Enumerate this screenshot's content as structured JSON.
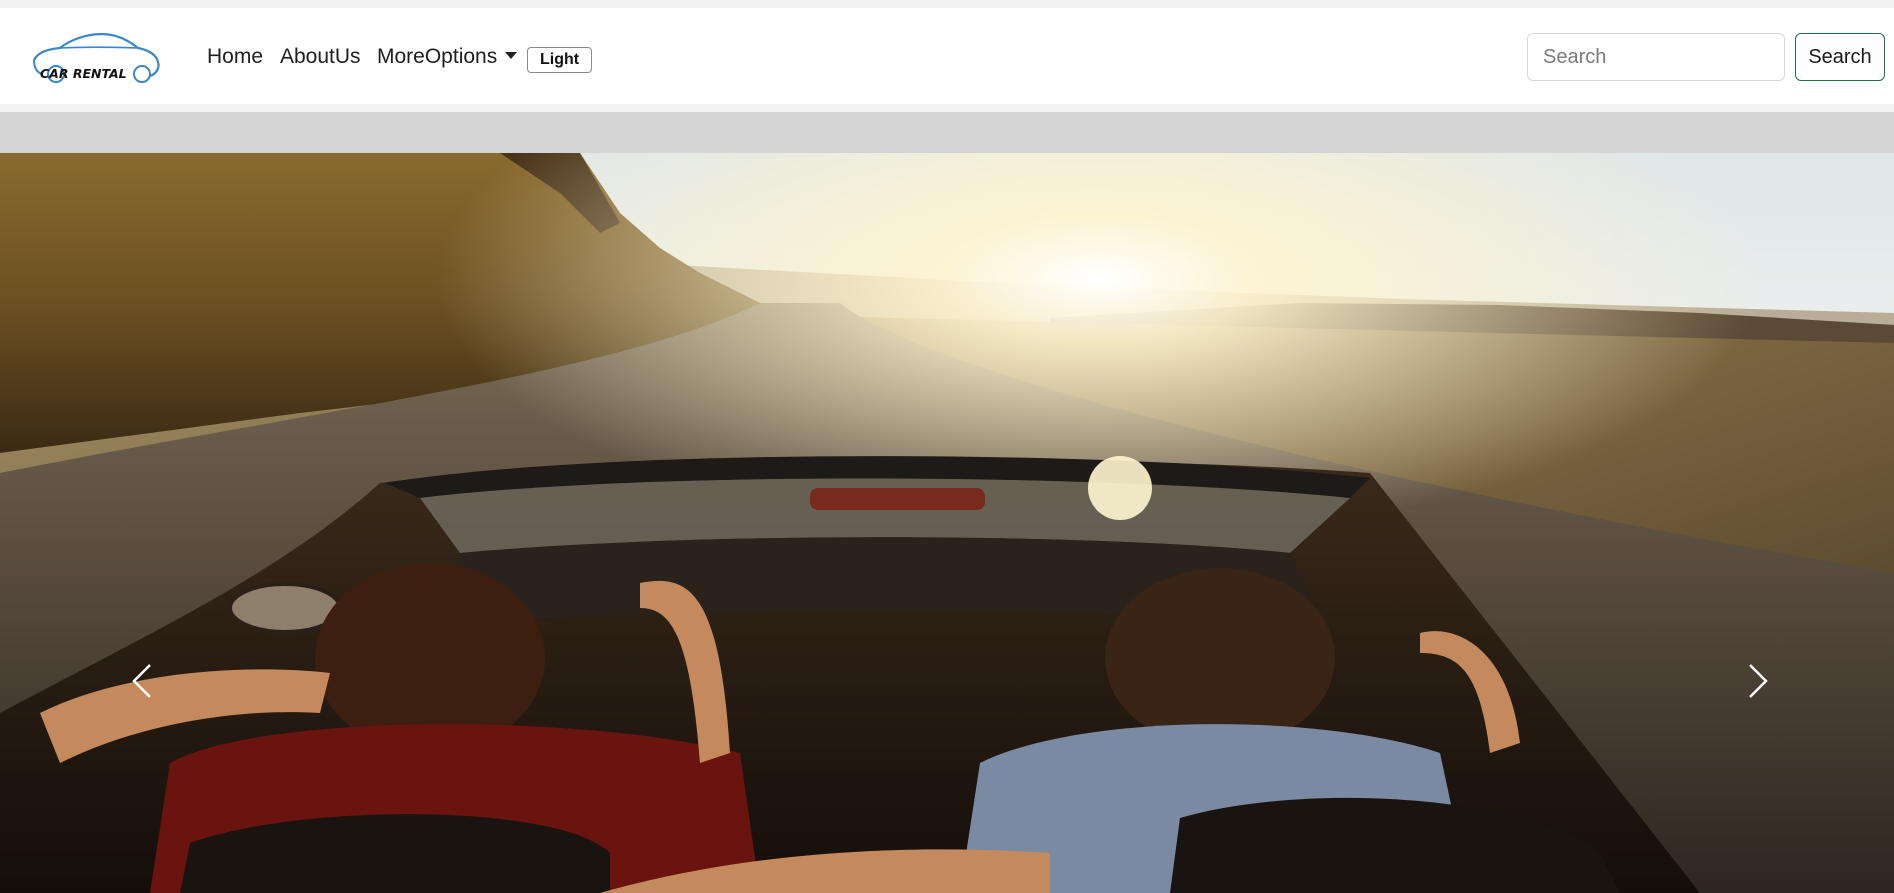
{
  "brand": {
    "logo_text": "CAR RENTAL"
  },
  "nav": {
    "items": [
      {
        "label": "Home"
      },
      {
        "label": "AboutUs"
      },
      {
        "label": "MoreOptions"
      }
    ],
    "theme_toggle_label": "Light"
  },
  "search": {
    "placeholder": "Search",
    "value": "",
    "button_label": "Search"
  },
  "carousel": {
    "prev_icon": "chevron-left-icon",
    "next_icon": "chevron-right-icon"
  },
  "colors": {
    "navbar_bg": "#ffffff",
    "band_bg": "#d4d4d4",
    "search_button_border": "#1f6f4a"
  }
}
